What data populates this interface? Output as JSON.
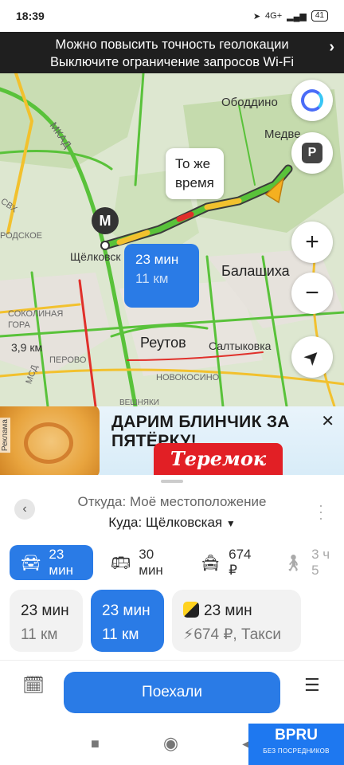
{
  "status_bar": {
    "time": "18:39",
    "network": "4G+",
    "battery": "41"
  },
  "banner": {
    "line1": "Можно повысить точность геолокации",
    "line2": "Выключите ограничение запросов Wi-Fi"
  },
  "map": {
    "labels": {
      "obolduino": "Ободдино",
      "medvezhi": "Медве",
      "mkad": "МКАД",
      "svkh": "СВХ",
      "rodskoe": "РОДСКОЕ",
      "shchelkovskaya": "Щёлковск",
      "balashikha": "Балашиха",
      "reutov": "Реутов",
      "saltykovka": "Салтыковка",
      "sokolinaya": "СОКОЛИНАЯ",
      "gora": "ГОРА",
      "perovo": "ПЕРОВО",
      "novokosino": "НОВОКОСИНО",
      "veshnyaki": "ВЕШНЯКИ",
      "msd": "МСД"
    },
    "scale": "3,9 км",
    "metro_letter": "М",
    "parking_letter": "P",
    "bubble_same_time": {
      "line1": "То же",
      "line2": "время"
    },
    "bubble_selected": {
      "time": "23 мин",
      "distance": "11 км"
    }
  },
  "ad": {
    "label": "Реклама",
    "slogan": "ДАРИМ БЛИНЧИК ЗА ПЯТЁРКУ!",
    "brand": "Теремок"
  },
  "sheet": {
    "from": "Откуда: Моё местоположение",
    "to": "Куда: Щёлковская",
    "modes": [
      {
        "icon": "car-icon",
        "label": "23 мин"
      },
      {
        "icon": "bus-icon",
        "label": "30 мин"
      },
      {
        "icon": "taxi-icon",
        "label": "674 ₽"
      },
      {
        "icon": "walk-icon",
        "label": "3 ч 5"
      }
    ],
    "routes": [
      {
        "time": "23 мин",
        "distance": "11 км"
      },
      {
        "time": "23 мин",
        "distance": "11 км"
      },
      {
        "time": "23 мин",
        "distance": "674 ₽, Такси"
      }
    ],
    "go_label": "Поехали"
  },
  "watermark": {
    "name": "BPRU",
    "tagline": "БЕЗ ПОСРЕДНИКОВ"
  },
  "colors": {
    "accent": "#2a7be6",
    "traffic_green": "#59c23a",
    "traffic_yellow": "#f2c12e",
    "traffic_red": "#e0302b"
  }
}
